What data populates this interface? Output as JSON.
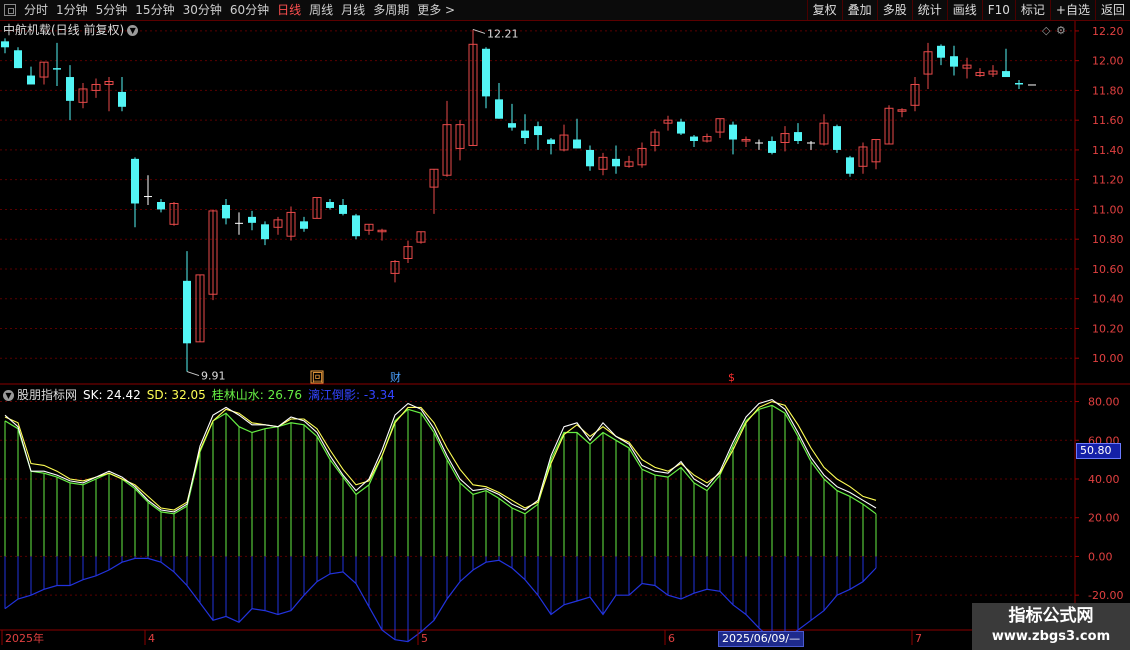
{
  "toolbar": {
    "periods": [
      "分时",
      "1分钟",
      "5分钟",
      "15分钟",
      "30分钟",
      "60分钟",
      "日线",
      "周线",
      "月线",
      "多周期",
      "更多 >"
    ],
    "active_period": "日线",
    "right_buttons": [
      "复权",
      "叠加",
      "多股",
      "统计",
      "画线",
      "F10",
      "标记",
      "+自选",
      "返回"
    ]
  },
  "chart": {
    "title": "中航机载(日线 前复权)",
    "high_label": "12.21",
    "low_label": "9.91",
    "event_markers": [
      "回",
      "财",
      "$"
    ],
    "price_ticks": [
      "12.20",
      "12.00",
      "11.80",
      "11.60",
      "11.40",
      "11.20",
      "11.00",
      "10.80",
      "10.60",
      "10.40",
      "10.20",
      "10.00"
    ],
    "price_tick_values": [
      12.2,
      12.0,
      11.8,
      11.6,
      11.4,
      11.2,
      11.0,
      10.8,
      10.6,
      10.4,
      10.2,
      10.0
    ],
    "price_range": [
      9.84,
      12.26
    ],
    "colors": {
      "up": "#e84a4a",
      "down": "#53f5f5",
      "flat": "#ffffff"
    }
  },
  "indicator": {
    "name": "股朋指标网",
    "sk_text": "SK: 24.42",
    "sd_text": "SD: 32.05",
    "gl_text": "桂林山水: 26.76",
    "ls_text": "漓江倒影: -3.34",
    "sd_badge": "50.80",
    "ticks": [
      "80.00",
      "60.00",
      "40.00",
      "20.00",
      "0.00",
      "-20.00"
    ],
    "tick_values": [
      80,
      60,
      40,
      20,
      0,
      -20
    ],
    "range": [
      -38,
      87
    ],
    "colors": {
      "sk": "#ffffff",
      "sd": "#ffff55",
      "gl": "#66ee44",
      "ls": "#2233dd"
    }
  },
  "time_axis": {
    "labels": [
      "2025年",
      "4",
      "5",
      "6",
      "7"
    ],
    "label_index": [
      0,
      11,
      32,
      51,
      70
    ],
    "date_badge": "2025/06/09/—"
  },
  "watermark": {
    "line1": "指标公式网",
    "line2": "www.zbgs3.com"
  },
  "chart_data": {
    "type": "candlestick",
    "series": [
      {
        "name": "OHLC",
        "ohlc": [
          [
            12.13,
            12.15,
            12.05,
            12.09
          ],
          [
            12.07,
            12.09,
            11.95,
            11.95
          ],
          [
            11.9,
            11.96,
            11.84,
            11.84
          ],
          [
            11.89,
            11.99,
            11.84,
            11.99
          ],
          [
            11.95,
            12.12,
            11.83,
            11.94
          ],
          [
            11.89,
            11.97,
            11.6,
            11.73
          ],
          [
            11.72,
            11.85,
            11.68,
            11.81
          ],
          [
            11.8,
            11.88,
            11.75,
            11.84
          ],
          [
            11.84,
            11.89,
            11.66,
            11.86
          ],
          [
            11.79,
            11.89,
            11.66,
            11.69
          ],
          [
            11.34,
            11.35,
            10.88,
            11.04
          ],
          [
            11.09,
            11.23,
            11.03,
            11.09
          ],
          [
            11.05,
            11.07,
            10.98,
            11.0
          ],
          [
            10.9,
            11.05,
            10.89,
            11.04
          ],
          [
            10.52,
            10.72,
            9.91,
            10.1
          ],
          [
            10.11,
            10.56,
            10.11,
            10.56
          ],
          [
            10.43,
            11.0,
            10.39,
            10.99
          ],
          [
            11.03,
            11.07,
            10.9,
            10.94
          ],
          [
            10.91,
            10.98,
            10.83,
            10.91
          ],
          [
            10.95,
            10.99,
            10.86,
            10.91
          ],
          [
            10.9,
            10.92,
            10.76,
            10.8
          ],
          [
            10.88,
            10.95,
            10.83,
            10.93
          ],
          [
            10.82,
            11.02,
            10.79,
            10.98
          ],
          [
            10.92,
            10.95,
            10.85,
            10.87
          ],
          [
            10.94,
            11.08,
            10.94,
            11.08
          ],
          [
            11.05,
            11.07,
            11.0,
            11.01
          ],
          [
            11.03,
            11.07,
            10.96,
            10.97
          ],
          [
            10.96,
            10.97,
            10.8,
            10.82
          ],
          [
            10.86,
            10.9,
            10.83,
            10.9
          ],
          [
            10.85,
            10.87,
            10.79,
            10.86
          ],
          [
            10.57,
            10.66,
            10.51,
            10.65
          ],
          [
            10.67,
            10.79,
            10.64,
            10.75
          ],
          [
            10.78,
            10.85,
            10.77,
            10.85
          ],
          [
            11.15,
            11.27,
            10.97,
            11.27
          ],
          [
            11.23,
            11.73,
            11.22,
            11.57
          ],
          [
            11.41,
            11.6,
            11.33,
            11.57
          ],
          [
            11.43,
            12.21,
            11.43,
            12.11
          ],
          [
            12.08,
            12.09,
            11.68,
            11.76
          ],
          [
            11.74,
            11.85,
            11.61,
            11.61
          ],
          [
            11.58,
            11.71,
            11.53,
            11.55
          ],
          [
            11.53,
            11.64,
            11.44,
            11.48
          ],
          [
            11.56,
            11.59,
            11.4,
            11.5
          ],
          [
            11.47,
            11.48,
            11.37,
            11.44
          ],
          [
            11.4,
            11.57,
            11.39,
            11.5
          ],
          [
            11.47,
            11.61,
            11.41,
            11.41
          ],
          [
            11.4,
            11.43,
            11.26,
            11.29
          ],
          [
            11.27,
            11.38,
            11.23,
            11.35
          ],
          [
            11.34,
            11.43,
            11.24,
            11.29
          ],
          [
            11.29,
            11.36,
            11.28,
            11.32
          ],
          [
            11.3,
            11.45,
            11.28,
            11.41
          ],
          [
            11.43,
            11.54,
            11.39,
            11.52
          ],
          [
            11.58,
            11.63,
            11.53,
            11.6
          ],
          [
            11.59,
            11.61,
            11.5,
            11.51
          ],
          [
            11.49,
            11.5,
            11.42,
            11.46
          ],
          [
            11.46,
            11.51,
            11.45,
            11.49
          ],
          [
            11.52,
            11.61,
            11.48,
            11.61
          ],
          [
            11.57,
            11.59,
            11.37,
            11.47
          ],
          [
            11.46,
            11.49,
            11.42,
            11.47
          ],
          [
            11.45,
            11.47,
            11.4,
            11.45
          ],
          [
            11.46,
            11.49,
            11.37,
            11.38
          ],
          [
            11.45,
            11.56,
            11.39,
            11.51
          ],
          [
            11.52,
            11.58,
            11.44,
            11.46
          ],
          [
            11.45,
            11.46,
            11.4,
            11.45
          ],
          [
            11.44,
            11.64,
            11.43,
            11.58
          ],
          [
            11.56,
            11.57,
            11.38,
            11.4
          ],
          [
            11.35,
            11.36,
            11.22,
            11.24
          ],
          [
            11.29,
            11.45,
            11.24,
            11.42
          ],
          [
            11.32,
            11.47,
            11.27,
            11.47
          ],
          [
            11.44,
            11.7,
            11.44,
            11.68
          ],
          [
            11.66,
            11.68,
            11.62,
            11.67
          ],
          [
            11.7,
            11.89,
            11.66,
            11.84
          ],
          [
            11.91,
            12.12,
            11.81,
            12.06
          ],
          [
            12.1,
            12.11,
            11.97,
            12.02
          ],
          [
            12.03,
            12.1,
            11.9,
            11.96
          ],
          [
            11.95,
            12.02,
            11.88,
            11.97
          ],
          [
            11.9,
            11.95,
            11.89,
            11.92
          ],
          [
            11.91,
            11.97,
            11.89,
            11.93
          ],
          [
            11.93,
            12.08,
            11.9,
            11.89
          ],
          [
            11.85,
            11.87,
            11.81,
            11.84
          ],
          [
            11.84,
            11.84,
            11.84,
            11.84
          ]
        ]
      },
      {
        "name": "SK",
        "values": [
          73,
          67,
          44,
          44,
          42,
          39,
          38,
          41,
          44,
          41,
          36,
          29,
          24,
          23,
          27,
          57,
          73,
          77,
          73,
          68,
          68,
          67,
          72,
          70,
          64,
          52,
          42,
          34,
          40,
          55,
          73,
          79,
          76,
          66,
          52,
          40,
          34,
          35,
          32,
          27,
          24,
          29,
          52,
          67,
          69,
          60,
          69,
          62,
          58,
          47,
          44,
          43,
          49,
          40,
          36,
          44,
          59,
          72,
          79,
          81,
          76,
          64,
          51,
          42,
          36,
          33,
          29,
          25
        ]
      },
      {
        "name": "SD",
        "values": [
          72,
          69,
          48,
          47,
          44,
          40,
          39,
          41,
          43,
          40,
          37,
          31,
          25,
          24,
          28,
          55,
          70,
          76,
          74,
          69,
          68,
          67,
          71,
          71,
          66,
          55,
          45,
          37,
          39,
          52,
          69,
          77,
          77,
          69,
          56,
          45,
          37,
          36,
          33,
          29,
          25,
          28,
          48,
          63,
          68,
          62,
          67,
          62,
          59,
          50,
          46,
          44,
          48,
          42,
          38,
          43,
          55,
          69,
          77,
          80,
          78,
          68,
          56,
          46,
          40,
          36,
          31,
          29
        ]
      },
      {
        "name": "桂林山水",
        "values": [
          70,
          66,
          44,
          43,
          41,
          38,
          37,
          40,
          43,
          40,
          35,
          28,
          23,
          22,
          26,
          54,
          70,
          74,
          67,
          64,
          66,
          67,
          69,
          68,
          62,
          50,
          41,
          32,
          37,
          52,
          70,
          76,
          74,
          64,
          50,
          38,
          32,
          34,
          30,
          25,
          22,
          27,
          50,
          64,
          64,
          58,
          64,
          60,
          56,
          45,
          42,
          41,
          46,
          38,
          34,
          42,
          57,
          70,
          76,
          78,
          74,
          62,
          49,
          40,
          34,
          31,
          27,
          22
        ]
      },
      {
        "name": "漓江倒影",
        "values": [
          -27,
          -22,
          -20,
          -17,
          -15,
          -15,
          -12,
          -10,
          -7,
          -3,
          -1,
          -1,
          -3,
          -8,
          -15,
          -24,
          -33,
          -31,
          -34,
          -27,
          -28,
          -30,
          -28,
          -20,
          -13,
          -9,
          -8,
          -14,
          -26,
          -38,
          -43,
          -44,
          -39,
          -33,
          -22,
          -13,
          -7,
          -3,
          -2,
          -6,
          -12,
          -20,
          -30,
          -25,
          -23,
          -21,
          -30,
          -20,
          -20,
          -14,
          -15,
          -20,
          -22,
          -19,
          -17,
          -18,
          -25,
          -30,
          -37,
          -43,
          -43,
          -38,
          -33,
          -28,
          -20,
          -17,
          -13,
          -6
        ]
      }
    ]
  }
}
